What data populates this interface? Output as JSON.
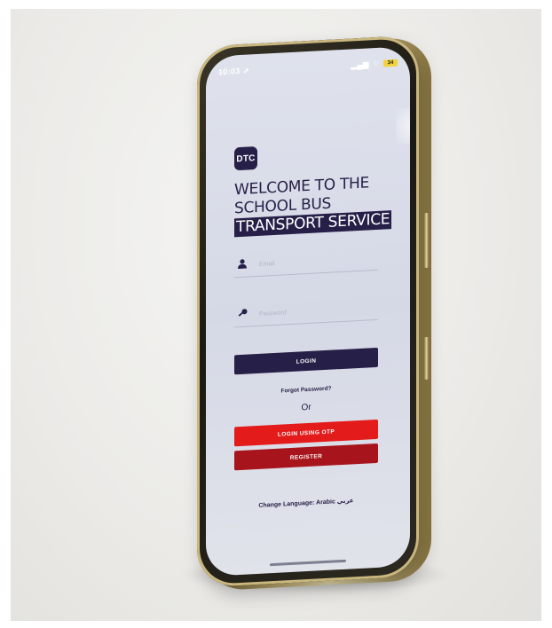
{
  "status_bar": {
    "time": "10:03 ⇗",
    "signal": "▂▄▆",
    "wifi": "⌔",
    "battery": "34"
  },
  "app": {
    "logo_text": "DTC",
    "welcome_line_1": "WELCOME TO THE",
    "welcome_line_2": "SCHOOL BUS",
    "welcome_line_3": "TRANSPORT SERVICE"
  },
  "form": {
    "email_placeholder": "Email",
    "password_placeholder": "Password",
    "email_icon": "user-icon",
    "password_icon": "key-icon"
  },
  "actions": {
    "login_label": "LOGIN",
    "forgot_password_label": "Forgot Password?",
    "or_label": "Or",
    "login_otp_label": "LOGIN USING OTP",
    "register_label": "REGISTER",
    "change_language_label": "Change Language: Arabic عربي"
  },
  "colors": {
    "brand_navy": "#262048",
    "otp_red": "#e31b1b",
    "register_red": "#a8141c",
    "frame_gold": "#c9b77d"
  }
}
